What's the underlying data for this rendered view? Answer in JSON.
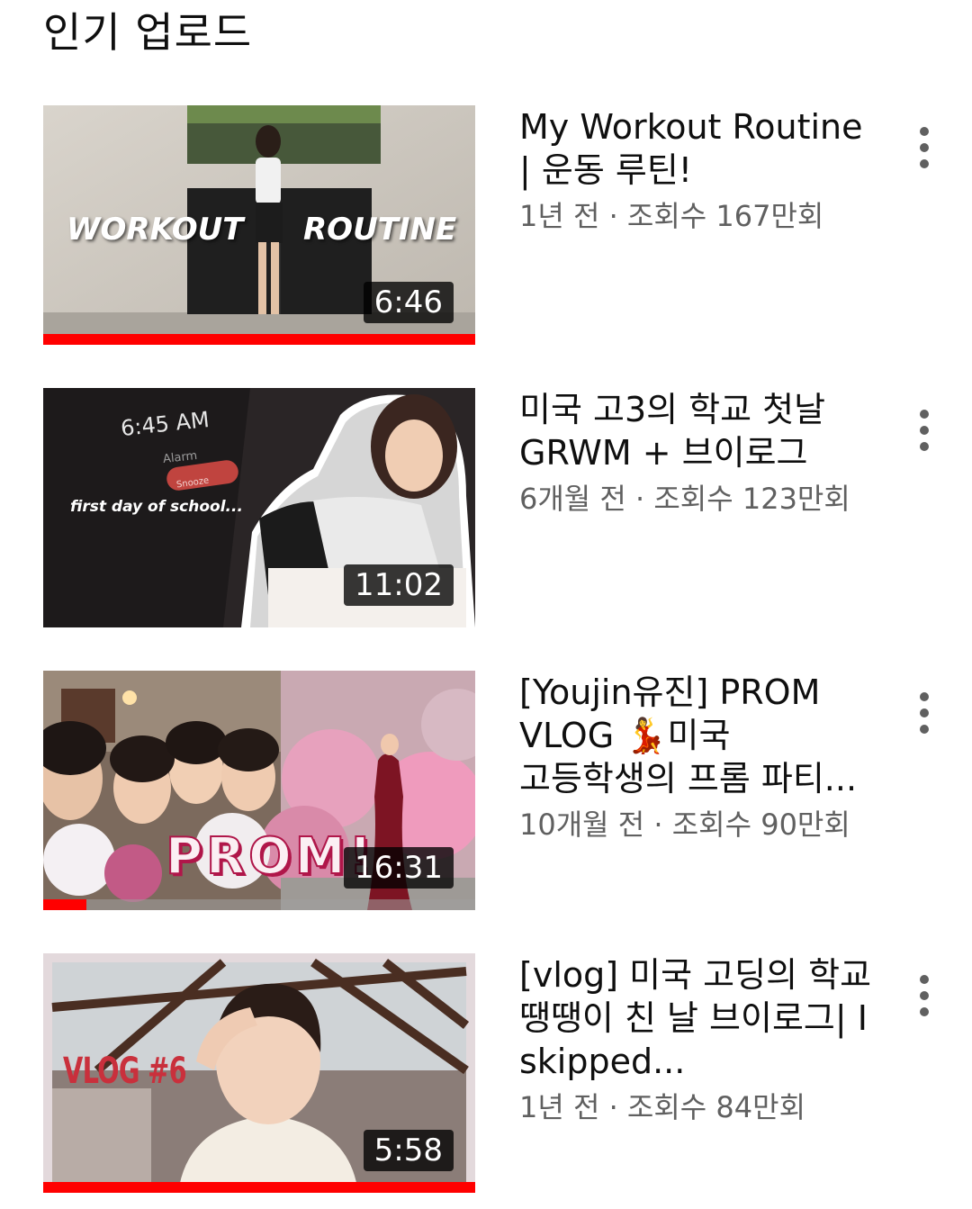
{
  "section": {
    "title": "인기 업로드"
  },
  "colors": {
    "progress": "#ff0000",
    "title_text": "#0f0f0f",
    "meta_text": "#606060"
  },
  "videos": [
    {
      "title": "My Workout Routine | 운동 루틴!",
      "meta": "1년 전 · 조회수 167만회",
      "duration": "6:46",
      "watched_fraction": 1.0,
      "overlay_left": "WORKOUT",
      "overlay_right": "ROUTINE",
      "menu_icon": "more-vert-icon"
    },
    {
      "title": "미국 고3의 학교 첫날 GRWM + 브이로그",
      "meta": "6개월 전 · 조회수 123만회",
      "duration": "11:02",
      "watched_fraction": 0.0,
      "overlay_time": "6:45 AM",
      "overlay_alarm": "Alarm",
      "overlay_snooze": "Snooze",
      "overlay_caption": "first day of school...",
      "menu_icon": "more-vert-icon"
    },
    {
      "title": "[Youjin유진] PROM VLOG 💃미국 고등학생의 프롬 파티...",
      "meta": "10개월 전 · 조회수 90만회",
      "duration": "16:31",
      "watched_fraction": 0.1,
      "overlay_text": "PROM!",
      "menu_icon": "more-vert-icon"
    },
    {
      "title": "[vlog] 미국 고딩의 학교 땡땡이 친 날 브이로그| I skipped...",
      "meta": "1년 전 · 조회수 84만회",
      "duration": "5:58",
      "watched_fraction": 1.0,
      "overlay_text": "VLOG #6",
      "menu_icon": "more-vert-icon"
    }
  ]
}
